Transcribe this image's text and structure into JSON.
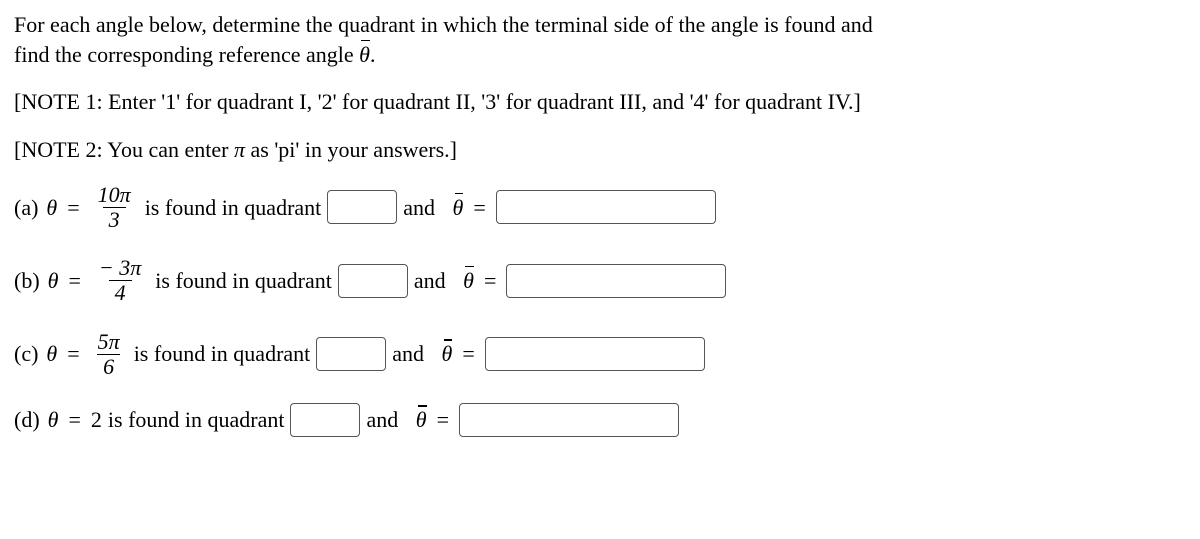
{
  "intro_line1": "For each angle below, determine the quadrant in which the terminal side of the angle is found and",
  "intro_line2_prefix": "find the corresponding reference angle ",
  "intro_line2_suffix": ".",
  "note1": "[NOTE 1: Enter '1' for quadrant I, '2' for quadrant II, '3' for quadrant III, and '4' for quadrant IV.]",
  "note2_prefix": "[NOTE 2: You can enter ",
  "note2_pi": "π",
  "note2_suffix": " as 'pi' in your answers.]",
  "found_text": " is found in quadrant ",
  "and_text": " and",
  "eq_sign": "=",
  "theta": "θ",
  "thetabar": "θ",
  "parts": {
    "a": {
      "label": "(a) ",
      "num": "10π",
      "den": "3"
    },
    "b": {
      "label": "(b) ",
      "num": "− 3π",
      "den": "4"
    },
    "c": {
      "label": "(c) ",
      "num": "5π",
      "den": "6"
    },
    "d": {
      "label": "(d) ",
      "value": "2"
    }
  }
}
